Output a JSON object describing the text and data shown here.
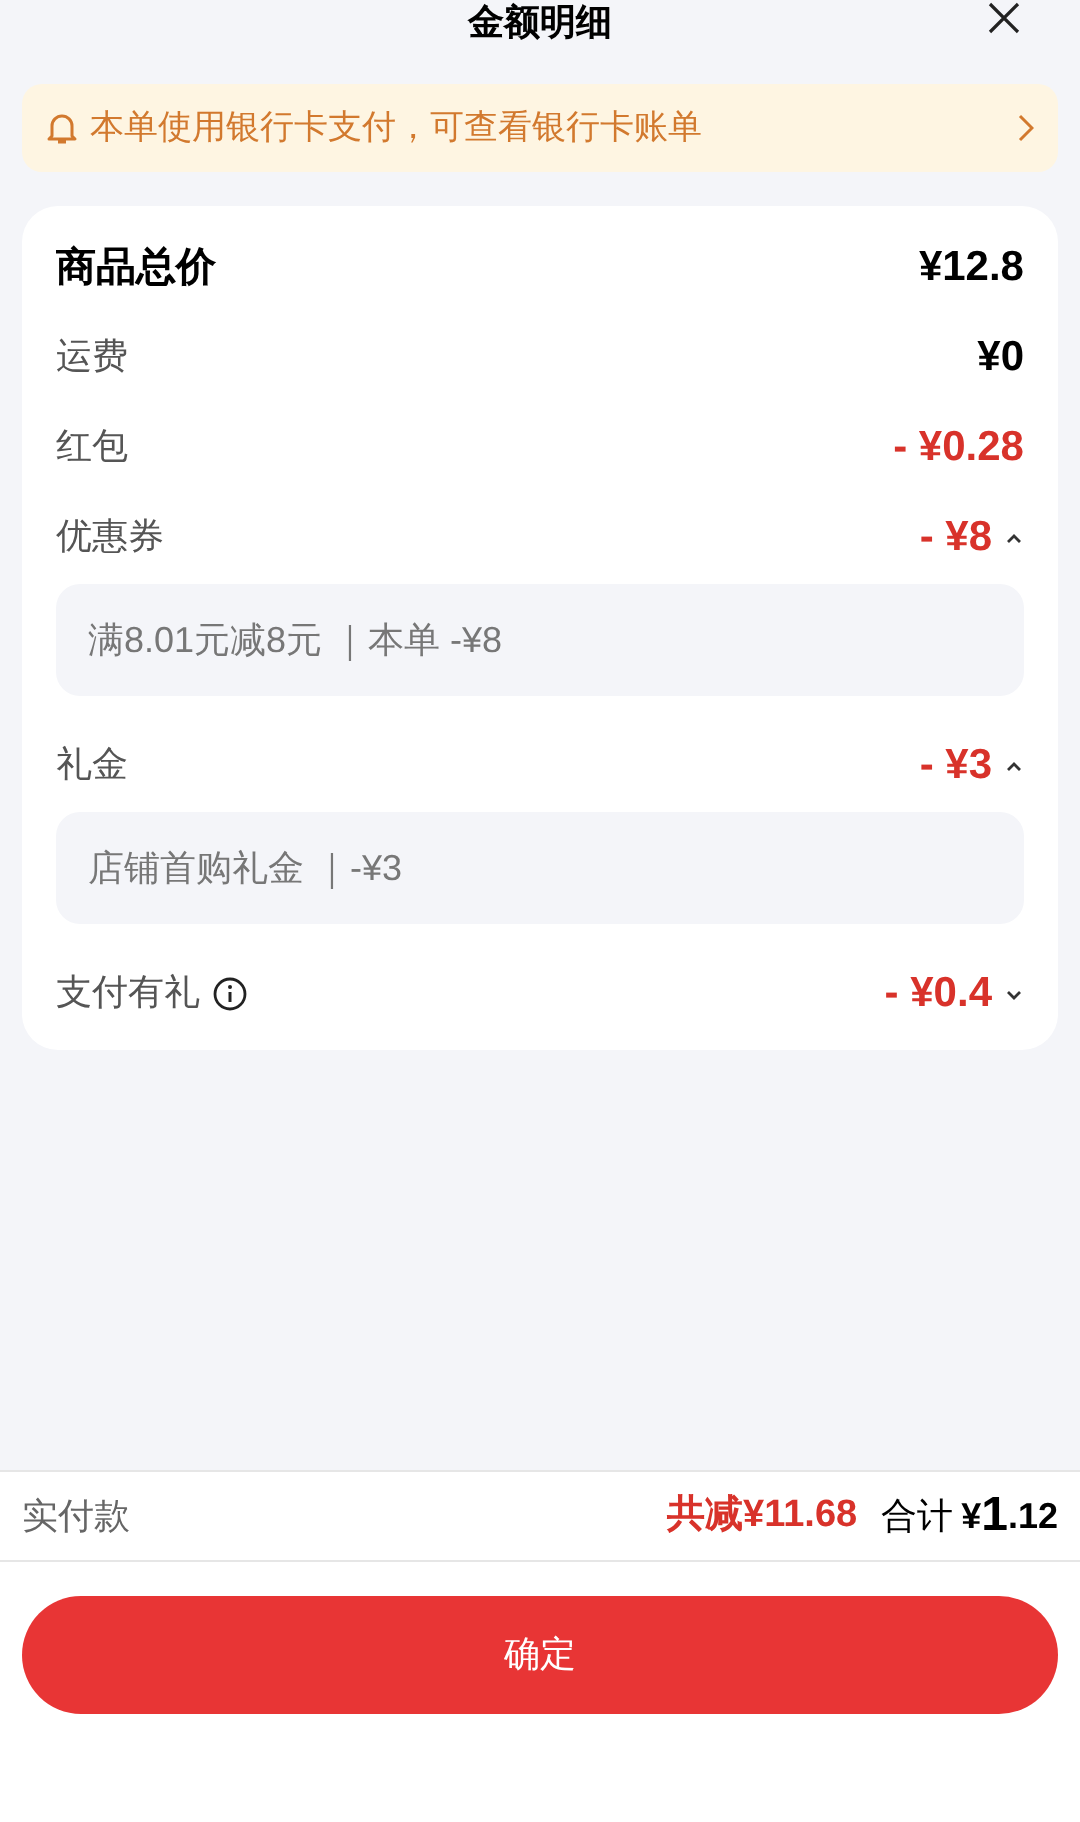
{
  "header": {
    "title": "金额明细"
  },
  "notice": {
    "text": "本单使用银行卡支付，可查看银行卡账单"
  },
  "rows": [
    {
      "kind": "total",
      "label": "商品总价",
      "value": "¥12.8"
    },
    {
      "kind": "plain",
      "label": "运费",
      "value": "¥0"
    },
    {
      "kind": "discount",
      "label": "红包",
      "value": "- ¥0.28"
    },
    {
      "kind": "discount",
      "label": "优惠券",
      "value": "- ¥8",
      "expanded": true,
      "detail": "满8.01元减8元 ｜本单 -¥8"
    },
    {
      "kind": "discount",
      "label": "礼金",
      "value": "- ¥3",
      "expanded": true,
      "detail": "店铺首购礼金 ｜-¥3"
    },
    {
      "kind": "discount",
      "label": "支付有礼",
      "value": "- ¥0.4",
      "info": true,
      "expanded": false
    }
  ],
  "summary": {
    "label": "实付款",
    "savings": "共减¥11.68",
    "total_label": "合计",
    "total_currency": "¥",
    "total_integer": "1",
    "total_decimal": ".12"
  },
  "confirm_button": "确定"
}
